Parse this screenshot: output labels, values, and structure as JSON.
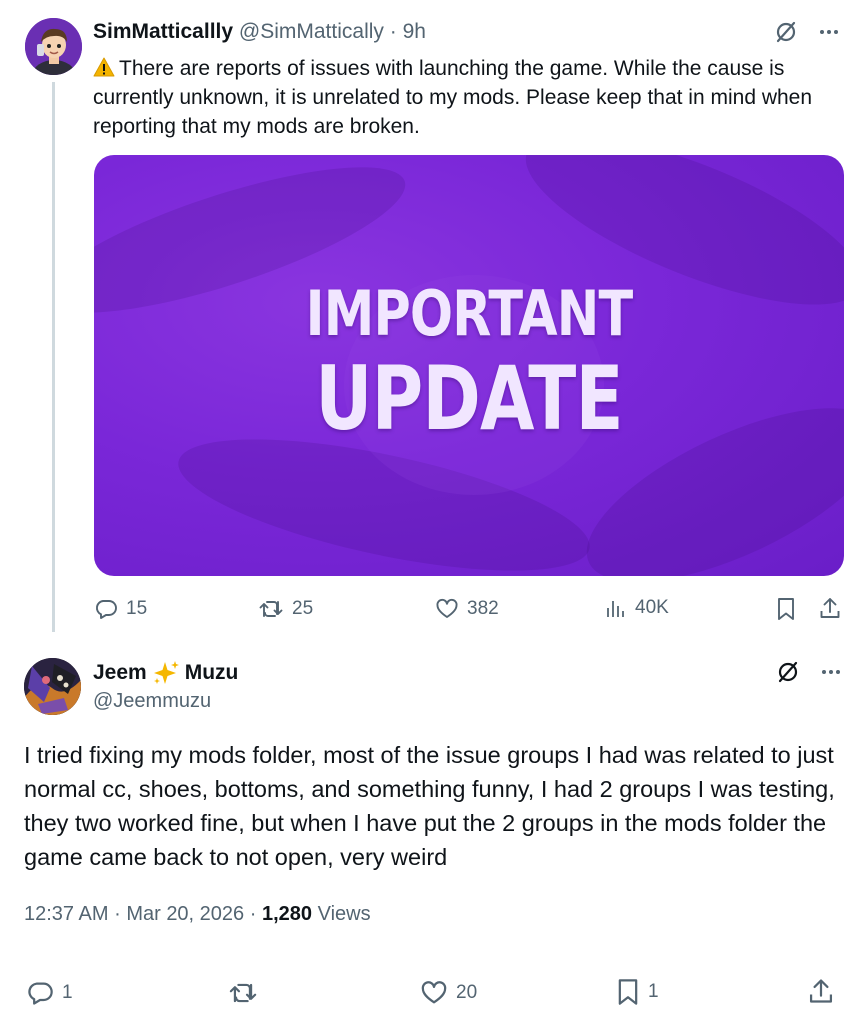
{
  "tweet1": {
    "display_name": "SimMatticallly",
    "handle": "@SimMattically",
    "time": "9h",
    "separator": "·",
    "text": "There are reports of issues with launching the game. While the cause is currently unknown, it is unrelated to my mods. Please keep that in mind when reporting that my mods are broken.",
    "media": {
      "line1": "IMPORTANT",
      "line2": "UPDATE"
    },
    "actions": {
      "replies": "15",
      "retweets": "25",
      "likes": "382",
      "views": "40K"
    }
  },
  "tweet2": {
    "display_name_part1": "Jeem",
    "display_name_part2": "Muzu",
    "handle": "@Jeemmuzu",
    "text": "I tried fixing my mods folder, most of the issue groups I had was related to just normal cc, shoes, bottoms, and something funny, I had 2 groups I was testing, they two worked fine, but when I have put the 2 groups in the mods folder the game came back to not open, very weird",
    "time": "12:37 AM",
    "date": "Mar 20, 2026",
    "separator": "·",
    "views_count": "1,280",
    "views_label": "Views",
    "actions": {
      "replies": "1",
      "likes": "20",
      "bookmarks": "1"
    }
  },
  "icons": {
    "avatar1": "avatar-cartoon-man-icon",
    "avatar2": "avatar-artwork-icon",
    "warning": "warning-emoji-icon",
    "grok": "grok-slash-icon",
    "more": "more-dots-icon",
    "reply": "reply-bubble-icon",
    "retweet": "retweet-arrows-icon",
    "like": "heart-icon",
    "views": "views-bars-icon",
    "bookmark": "bookmark-icon",
    "share": "share-upload-icon",
    "sparkles": "sparkles-emoji-icon"
  },
  "colors": {
    "text": "#0f1419",
    "muted": "#536471",
    "media_purple": "#7a27d8",
    "media_text": "#f1e6ff",
    "thread_line": "#cfd9de"
  }
}
